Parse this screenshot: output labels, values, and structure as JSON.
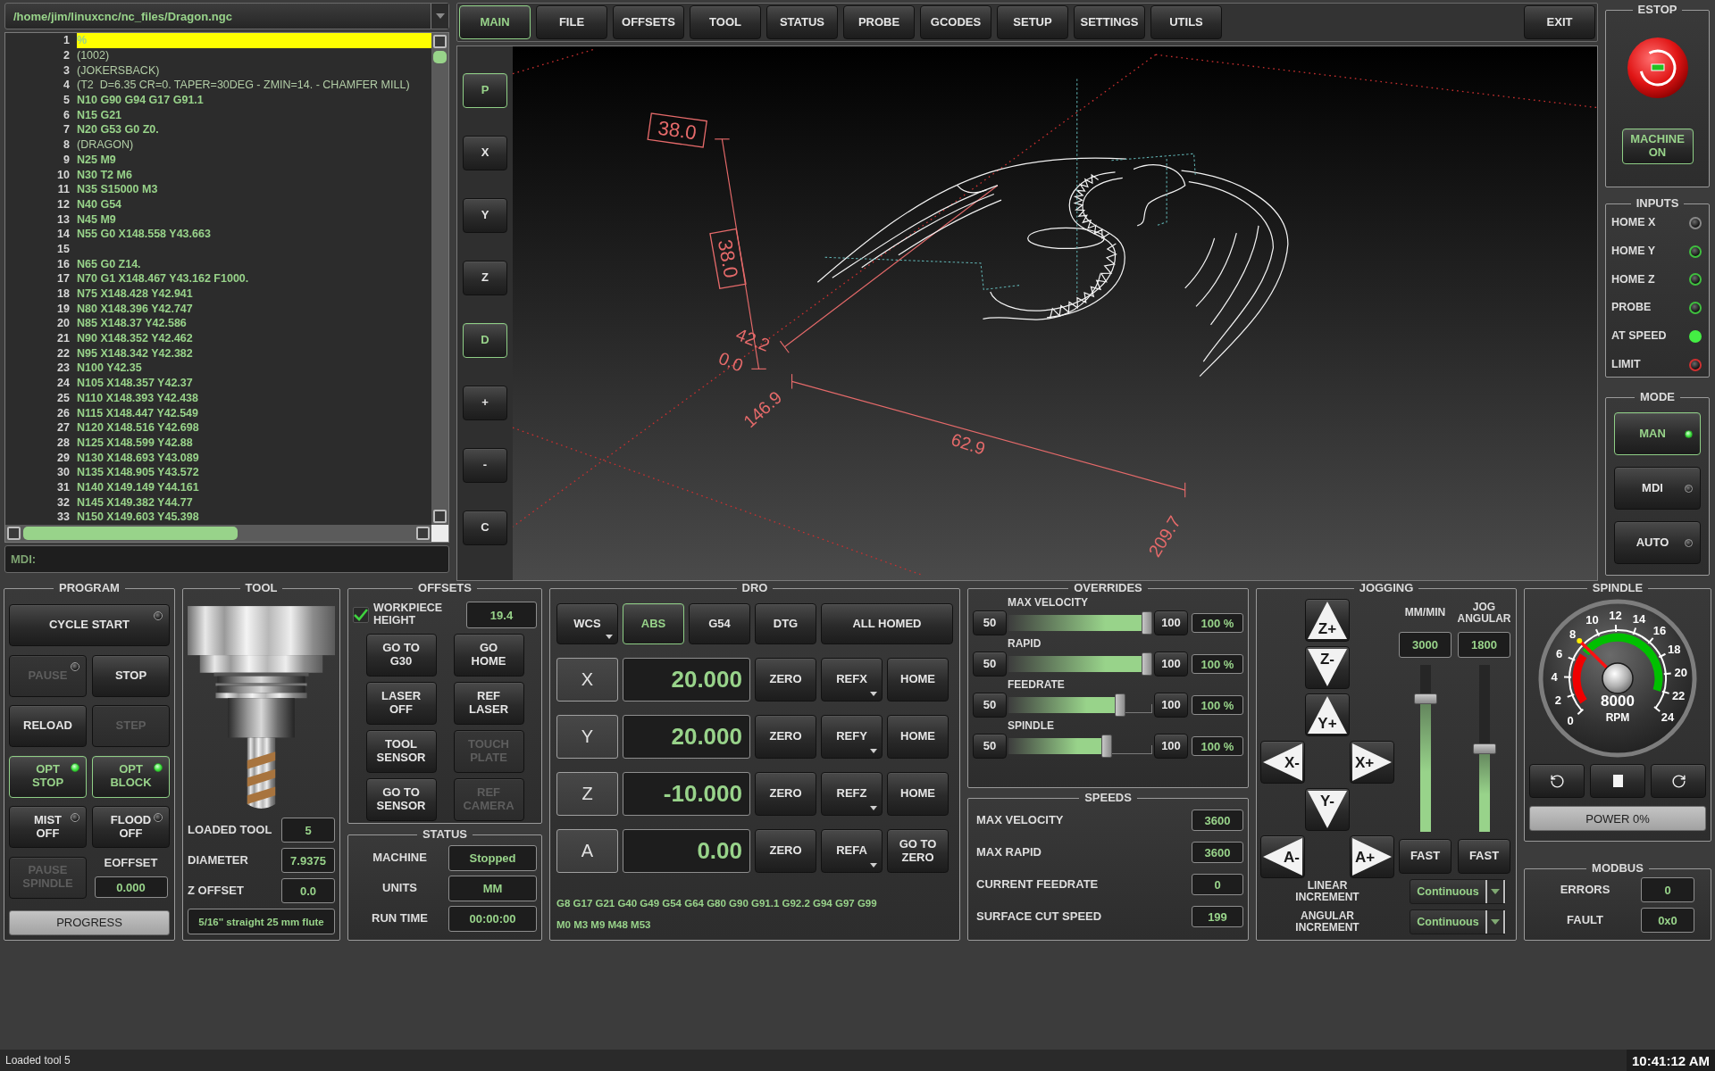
{
  "file_selector": {
    "path": "/home/jim/linuxcnc/nc_files/Dragon.ngc"
  },
  "editor": {
    "lines": [
      {
        "number": "1",
        "text": "%",
        "kind": "code",
        "selected": true
      },
      {
        "number": "2",
        "text": "(1002)",
        "kind": "comment",
        "selected": false
      },
      {
        "number": "3",
        "text": "(JOKERSBACK)",
        "kind": "comment",
        "selected": false
      },
      {
        "number": "4",
        "text": "(T2  D=6.35 CR=0. TAPER=30DEG - ZMIN=14. - CHAMFER MILL)",
        "kind": "comment",
        "selected": false
      },
      {
        "number": "5",
        "text": "N10 G90 G94 G17 G91.1",
        "kind": "code",
        "selected": false
      },
      {
        "number": "6",
        "text": "N15 G21",
        "kind": "code",
        "selected": false
      },
      {
        "number": "7",
        "text": "N20 G53 G0 Z0.",
        "kind": "code",
        "selected": false
      },
      {
        "number": "8",
        "text": "(DRAGON)",
        "kind": "comment",
        "selected": false
      },
      {
        "number": "9",
        "text": "N25 M9",
        "kind": "code",
        "selected": false
      },
      {
        "number": "10",
        "text": "N30 T2 M6",
        "kind": "code",
        "selected": false
      },
      {
        "number": "11",
        "text": "N35 S15000 M3",
        "kind": "code",
        "selected": false
      },
      {
        "number": "12",
        "text": "N40 G54",
        "kind": "code",
        "selected": false
      },
      {
        "number": "13",
        "text": "N45 M9",
        "kind": "code",
        "selected": false
      },
      {
        "number": "14",
        "text": "N55 G0 X148.558 Y43.663",
        "kind": "code",
        "selected": false
      },
      {
        "number": "15",
        "selected": false
      },
      {
        "number": "16",
        "text": "N65 G0 Z14.",
        "kind": "code",
        "selected": false
      },
      {
        "number": "17",
        "text": "N70 G1 X148.467 Y43.162 F1000.",
        "kind": "code",
        "selected": false
      },
      {
        "number": "18",
        "text": "N75 X148.428 Y42.941",
        "kind": "code",
        "selected": false
      },
      {
        "number": "19",
        "text": "N80 X148.396 Y42.747",
        "kind": "code",
        "selected": false
      },
      {
        "number": "20",
        "text": "N85 X148.37 Y42.586",
        "kind": "code",
        "selected": false
      },
      {
        "number": "21",
        "text": "N90 X148.352 Y42.462",
        "kind": "code",
        "selected": false
      },
      {
        "number": "22",
        "text": "N95 X148.342 Y42.382",
        "kind": "code",
        "selected": false
      },
      {
        "number": "23",
        "text": "N100 Y42.35",
        "kind": "code",
        "selected": false
      },
      {
        "number": "24",
        "text": "N105 X148.357 Y42.37",
        "kind": "code",
        "selected": false
      },
      {
        "number": "25",
        "text": "N110 X148.393 Y42.438",
        "kind": "code",
        "selected": false
      },
      {
        "number": "26",
        "text": "N115 X148.447 Y42.549",
        "kind": "code",
        "selected": false
      },
      {
        "number": "27",
        "text": "N120 X148.516 Y42.698",
        "kind": "code",
        "selected": false
      },
      {
        "number": "28",
        "text": "N125 X148.599 Y42.88",
        "kind": "code",
        "selected": false
      },
      {
        "number": "29",
        "text": "N130 X148.693 Y43.089",
        "kind": "code",
        "selected": false
      },
      {
        "number": "30",
        "text": "N135 X148.905 Y43.572",
        "kind": "code",
        "selected": false
      },
      {
        "number": "31",
        "text": "N140 X149.149 Y44.161",
        "kind": "code",
        "selected": false
      },
      {
        "number": "32",
        "text": "N145 X149.382 Y44.77",
        "kind": "code",
        "selected": false
      },
      {
        "number": "33",
        "text": "N150 X149.603 Y45.398",
        "kind": "code",
        "selected": false
      }
    ]
  },
  "mdi": {
    "placeholder": "MDI:"
  },
  "nav_tabs": [
    {
      "label": "MAIN",
      "selected": true
    },
    {
      "label": "FILE",
      "selected": false
    },
    {
      "label": "OFFSETS",
      "selected": false
    },
    {
      "label": "TOOL",
      "selected": false
    },
    {
      "label": "STATUS",
      "selected": false
    },
    {
      "label": "PROBE",
      "selected": false
    },
    {
      "label": "GCODES",
      "selected": false
    },
    {
      "label": "SETUP",
      "selected": false
    },
    {
      "label": "SETTINGS",
      "selected": false
    },
    {
      "label": "UTILS",
      "selected": false
    }
  ],
  "exit_button": {
    "label": "EXIT"
  },
  "view_buttons": [
    {
      "label": "P",
      "on": true
    },
    {
      "label": "X",
      "on": false
    },
    {
      "label": "Y",
      "on": false
    },
    {
      "label": "Z",
      "on": false
    },
    {
      "label": "D",
      "on": true
    },
    {
      "label": "+",
      "on": false
    },
    {
      "label": "-",
      "on": false
    },
    {
      "label": "C",
      "on": false
    }
  ],
  "preview": {
    "dimension_labels": [
      "38.0",
      "38.0",
      "42.2",
      "0.0",
      "146.9",
      "62.9",
      "209.7"
    ]
  },
  "estop": {
    "title": "ESTOP",
    "machine_button": {
      "label": "MACHINE\nON",
      "on": true
    }
  },
  "inputs": {
    "title": "INPUTS",
    "items": [
      {
        "label": "HOME X",
        "on": false,
        "color": "#8a8a8a"
      },
      {
        "label": "HOME Y",
        "on": false,
        "color": "#3fbf3f"
      },
      {
        "label": "HOME Z",
        "on": false,
        "color": "#3fbf3f"
      },
      {
        "label": "PROBE",
        "on": false,
        "color": "#3fbf3f"
      },
      {
        "label": "AT SPEED",
        "on": true,
        "color": "#44ee44"
      },
      {
        "label": "LIMIT",
        "on": false,
        "color": "#d03030"
      }
    ]
  },
  "mode": {
    "title": "MODE",
    "items": [
      {
        "label": "MAN",
        "selected": true
      },
      {
        "label": "MDI",
        "selected": false
      },
      {
        "label": "AUTO",
        "selected": false
      }
    ]
  },
  "program": {
    "title": "PROGRAM",
    "cycle_start": {
      "label": "CYCLE START",
      "on": false
    },
    "buttons": [
      {
        "label": "PAUSE",
        "kind": "led",
        "on": false,
        "disabled": true
      },
      {
        "label": "STOP",
        "kind": "plain",
        "on": false,
        "disabled": false
      },
      {
        "label": "RELOAD",
        "kind": "plain",
        "on": false,
        "disabled": false
      },
      {
        "label": "STEP",
        "kind": "plain",
        "on": false,
        "disabled": true
      },
      {
        "label": "OPT\nSTOP",
        "kind": "led",
        "on": true,
        "disabled": false
      },
      {
        "label": "OPT\nBLOCK",
        "kind": "led",
        "on": true,
        "disabled": false
      },
      {
        "label": "MIST\nOFF",
        "kind": "led",
        "on": false,
        "disabled": false
      },
      {
        "label": "FLOOD\nOFF",
        "kind": "led",
        "on": false,
        "disabled": false
      },
      {
        "label": "PAUSE\nSPINDLE",
        "kind": "plain",
        "on": false,
        "disabled": true
      }
    ],
    "eoffset": {
      "label": "EOFFSET",
      "value": "0.000"
    },
    "progress": {
      "label": "PROGRESS",
      "level": 0
    }
  },
  "tool": {
    "title": "TOOL",
    "fields": [
      {
        "label": "LOADED TOOL",
        "value": "5"
      },
      {
        "label": "DIAMETER",
        "value": "7.9375"
      },
      {
        "label": "Z OFFSET",
        "value": "0.0"
      }
    ],
    "description": "5/16\" straight 25 mm flute"
  },
  "offsets": {
    "title": "OFFSETS",
    "workpiece_height": {
      "label": "WORKPIECE\nHEIGHT",
      "checked": true,
      "value": "19.4"
    },
    "buttons": [
      {
        "label": "GO TO\nG30",
        "disabled": false
      },
      {
        "label": "GO\nHOME",
        "disabled": false
      },
      {
        "label": "LASER\nOFF",
        "disabled": false
      },
      {
        "label": "REF\nLASER",
        "disabled": false
      },
      {
        "label": "TOOL\nSENSOR",
        "disabled": false
      },
      {
        "label": "TOUCH\nPLATE",
        "disabled": true
      },
      {
        "label": "GO TO\nSENSOR",
        "disabled": false
      },
      {
        "label": "REF\nCAMERA",
        "disabled": true
      }
    ]
  },
  "status": {
    "title": "STATUS",
    "fields": [
      {
        "label": "MACHINE",
        "value": "Stopped"
      },
      {
        "label": "UNITS",
        "value": "MM"
      },
      {
        "label": "RUN TIME",
        "value": "00:00:00"
      }
    ]
  },
  "dro": {
    "title": "DRO",
    "modes": [
      {
        "label": "WCS",
        "kind": "menu",
        "selected": false
      },
      {
        "label": "ABS",
        "kind": "plain",
        "selected": true
      },
      {
        "label": "G54",
        "kind": "plain",
        "selected": false
      },
      {
        "label": "DTG",
        "kind": "plain",
        "selected": false
      },
      {
        "label": "ALL HOMED",
        "kind": "plain",
        "selected": false
      }
    ],
    "axes": [
      {
        "axis": "X",
        "value": "20.000",
        "buttons": [
          {
            "label": "ZERO",
            "kind": "plain"
          },
          {
            "label": "REFX",
            "kind": "menu"
          },
          {
            "label": "HOME",
            "kind": "plain"
          }
        ]
      },
      {
        "axis": "Y",
        "value": "20.000",
        "buttons": [
          {
            "label": "ZERO",
            "kind": "plain"
          },
          {
            "label": "REFY",
            "kind": "menu"
          },
          {
            "label": "HOME",
            "kind": "plain"
          }
        ]
      },
      {
        "axis": "Z",
        "value": "-10.000",
        "buttons": [
          {
            "label": "ZERO",
            "kind": "plain"
          },
          {
            "label": "REFZ",
            "kind": "menu"
          },
          {
            "label": "HOME",
            "kind": "plain"
          }
        ]
      },
      {
        "axis": "A",
        "value": "0.00",
        "buttons": [
          {
            "label": "ZERO",
            "kind": "plain"
          },
          {
            "label": "REFA",
            "kind": "menu"
          },
          {
            "label": "GO TO\nZERO",
            "kind": "plain"
          }
        ]
      }
    ],
    "active_codes": [
      "G8 G17 G21 G40 G49 G54 G64 G80 G90 G91.1 G92.2 G94 G97 G99",
      "M0 M3 M9 M48 M53"
    ]
  },
  "overrides": {
    "title": "OVERRIDES",
    "items": [
      {
        "label": "MAX VELOCITY",
        "min": "50",
        "max": "100",
        "reading": "100 %",
        "level": 1
      },
      {
        "label": "RAPID",
        "min": "50",
        "max": "100",
        "reading": "100 %",
        "level": 1
      },
      {
        "label": "FEEDRATE",
        "min": "50",
        "max": "100",
        "reading": "100 %",
        "level": 0.8
      },
      {
        "label": "SPINDLE",
        "min": "50",
        "max": "100",
        "reading": "100 %",
        "level": 0.7
      }
    ]
  },
  "speeds": {
    "title": "SPEEDS",
    "items": [
      {
        "label": "MAX VELOCITY",
        "value": "3600"
      },
      {
        "label": "MAX RAPID",
        "value": "3600"
      },
      {
        "label": "CURRENT FEEDRATE",
        "value": "0"
      },
      {
        "label": "SURFACE CUT SPEED",
        "value": "199"
      }
    ]
  },
  "jogging": {
    "title": "JOGGING",
    "buttons": [
      {
        "label": "Z+",
        "kind": "up"
      },
      {
        "label": "Z-",
        "kind": "down"
      },
      {
        "label": "Y+",
        "kind": "up"
      },
      {
        "label": "X-",
        "kind": "left"
      },
      {
        "label": "X+",
        "kind": "right"
      },
      {
        "label": "Y-",
        "kind": "down"
      },
      {
        "label": "A-",
        "kind": "left"
      },
      {
        "label": "A+",
        "kind": "right"
      }
    ],
    "rates": [
      {
        "label": "MM/MIN",
        "value": "3000",
        "level": 0.82,
        "fast_label": "FAST"
      },
      {
        "label": "JOG\nANGULAR",
        "value": "1800",
        "level": 0.5,
        "fast_label": "FAST"
      }
    ],
    "increments": [
      {
        "label": "LINEAR\nINCREMENT",
        "value": "Continuous"
      },
      {
        "label": "ANGULAR\nINCREMENT",
        "value": "Continuous"
      }
    ]
  },
  "spindle": {
    "title": "SPINDLE",
    "gauge": {
      "scale": [
        "10",
        "12",
        "14",
        "8",
        "16",
        "6",
        "18",
        "4",
        "20",
        "2",
        "22",
        "0",
        "24"
      ],
      "reading": "8000",
      "unit": "RPM",
      "level": 0.333
    },
    "power": {
      "label": "POWER 0%",
      "level": 0
    }
  },
  "modbus": {
    "title": "MODBUS",
    "fields": [
      {
        "label": "ERRORS",
        "value": "0"
      },
      {
        "label": "FAULT",
        "value": "0x0"
      }
    ]
  },
  "status_bar": {
    "message": "Loaded tool 5",
    "clock": "10:41:12 AM"
  }
}
